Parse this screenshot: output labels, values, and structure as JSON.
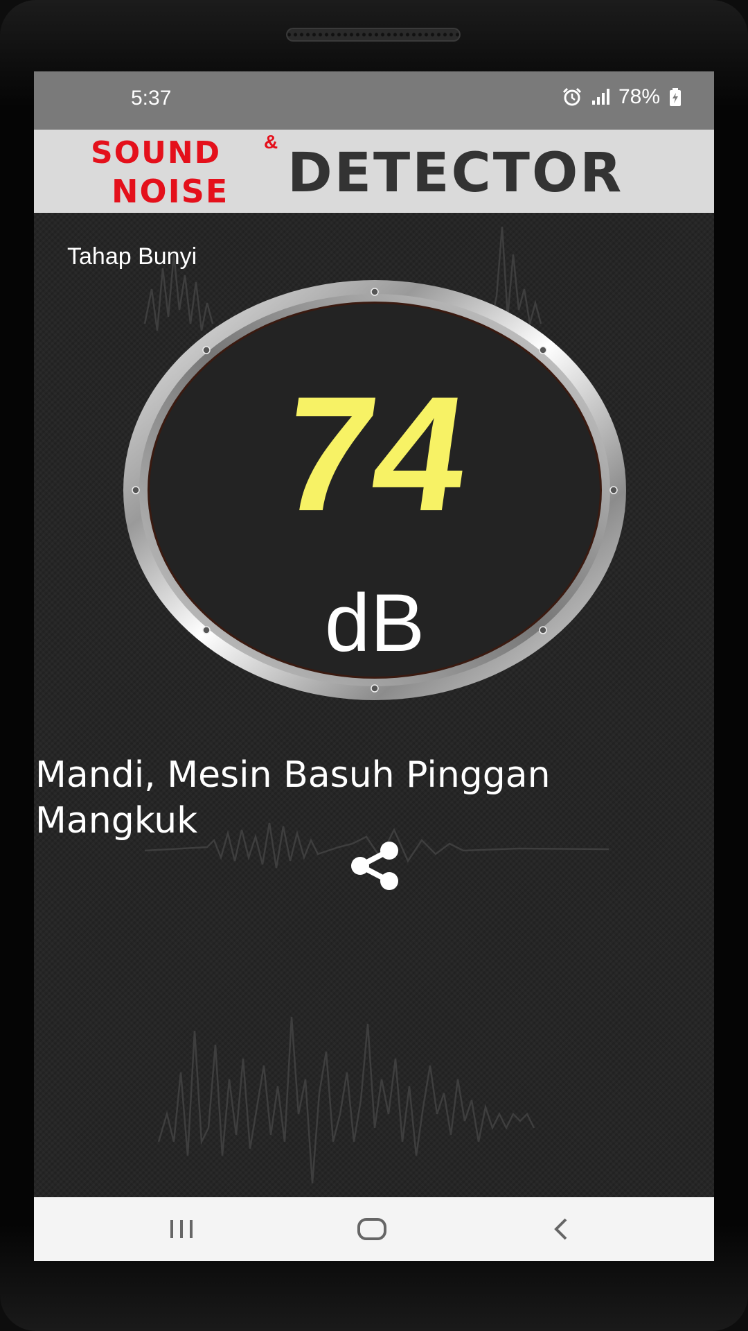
{
  "status_bar": {
    "time": "5:37",
    "battery": "78%",
    "icons": [
      "alarm-icon",
      "signal-icon",
      "battery-charging-icon"
    ]
  },
  "banner": {
    "logo_sound": "SOUND",
    "logo_amp": "&",
    "logo_noise": "NOISE",
    "logo_detector": "DETECTOR"
  },
  "meter": {
    "label": "Tahap Bunyi",
    "value": "74",
    "unit": "dB"
  },
  "description": "Mandi, Mesin Basuh Pinggan Mangkuk",
  "share": {
    "icon": "share-icon"
  },
  "navbar": {
    "icons": [
      "recent-apps-icon",
      "home-icon",
      "back-icon"
    ]
  },
  "colors": {
    "banner_red": "#e4101b",
    "banner_dark": "#333333",
    "value_yellow": "#f7f265",
    "background": "#262626",
    "statusbar": "#7a7a7a"
  }
}
